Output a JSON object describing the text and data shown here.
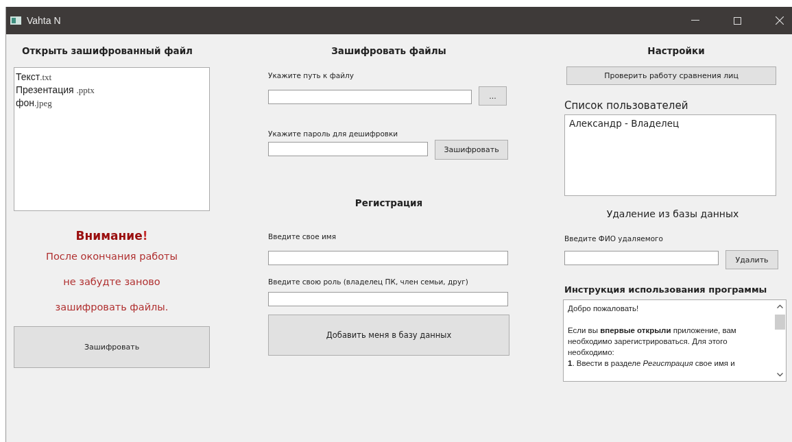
{
  "window": {
    "title": "Vahta N"
  },
  "open_panel": {
    "heading": "Открыть зашифрованный файл",
    "files": [
      {
        "name": "Текст",
        "ext": ".txt"
      },
      {
        "name": "Презентация ",
        "ext": ".pptx"
      },
      {
        "name": "фон",
        "ext": ".jpeg"
      }
    ]
  },
  "warning": {
    "title": "Внимание",
    "mark": "!",
    "lines": [
      "После окончания работы",
      "не забудте заново",
      "зашифровать файлы."
    ]
  },
  "encrypt_again_button": "Зашифровать",
  "encrypt_panel": {
    "heading": "Зашифровать файлы",
    "path_label": "Укажите путь к файлу",
    "browse_button": "...",
    "password_label": "Укажите пароль для дешифровки",
    "encrypt_button": "Зашифровать"
  },
  "registration": {
    "heading": "Регистрация",
    "name_label": "Введите свое имя",
    "role_label": "Введите свою роль (владелец ПК, член семьи, друг)",
    "add_button": "Добавить меня в базу данных"
  },
  "settings": {
    "heading": "Настройки",
    "check_button": "Проверить работу сравнения лиц",
    "users_label": "Список пользователей",
    "users": [
      "Александр - Владелец"
    ],
    "delete_heading": "Удаление из базы данных",
    "delete_label": "Введите ФИО удаляемого",
    "delete_button": "Удалить"
  },
  "instructions": {
    "heading": "Инструкция использования программы",
    "paragraphs": [
      "Добро пожаловать!",
      "Если вы **впервые открыли** приложение, вам необходимо зарегистрироваться. Для этого необходимо:\n**1**. Ввести в разделе *Регистрация* свое имя и"
    ]
  }
}
